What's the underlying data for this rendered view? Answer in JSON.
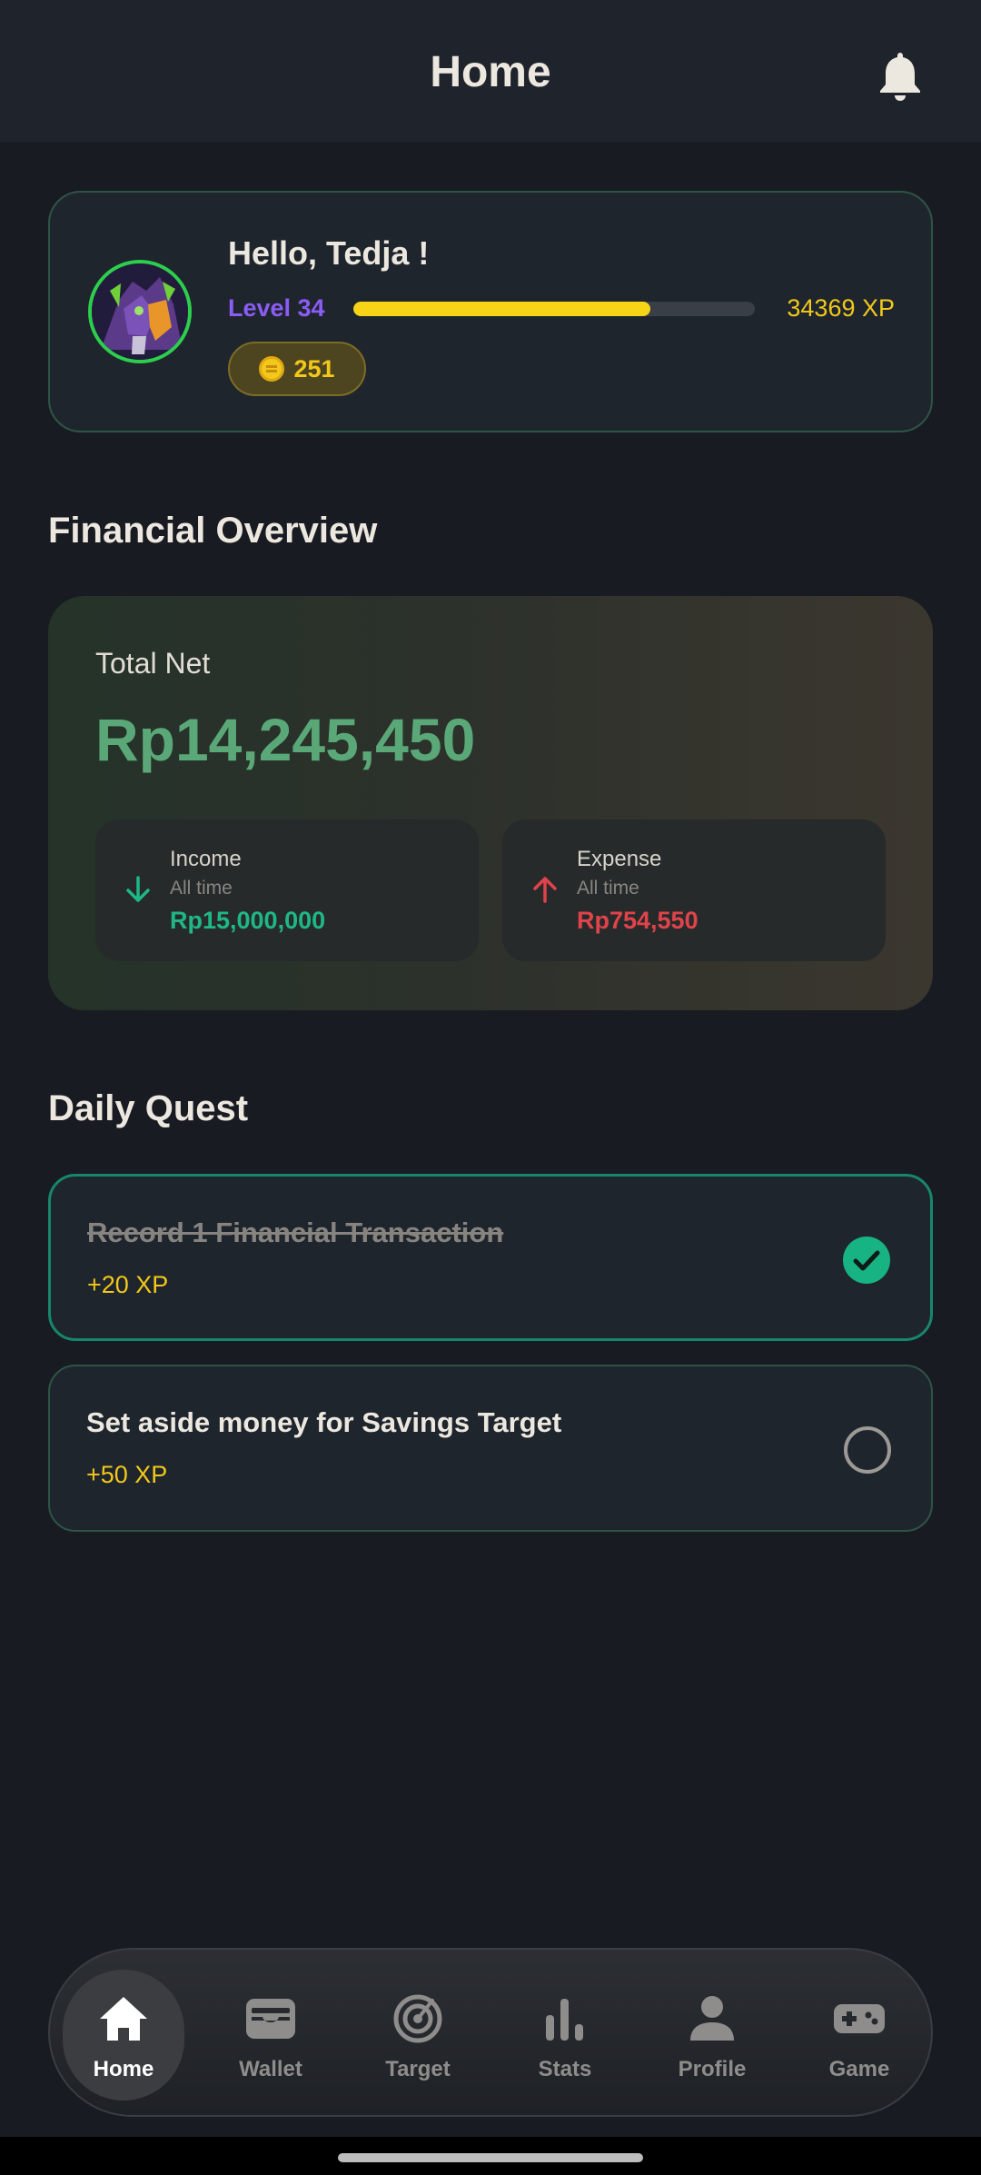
{
  "header": {
    "title": "Home",
    "notification_icon": "bell-icon"
  },
  "profile": {
    "greeting": "Hello, Tedja !",
    "level_label": "Level 34",
    "xp_label": "34369 XP",
    "xp_progress": 0.74,
    "coins": "251",
    "coin_icon": "coin-icon"
  },
  "overview": {
    "section_title": "Financial Overview",
    "total_label": "Total Net",
    "total_value": "Rp14,245,450",
    "income": {
      "label": "Income",
      "period": "All time",
      "value": "Rp15,000,000",
      "icon": "arrow-down-icon"
    },
    "expense": {
      "label": "Expense",
      "period": "All time",
      "value": "Rp754,550",
      "icon": "arrow-up-icon"
    }
  },
  "quests": {
    "section_title": "Daily Quest",
    "items": [
      {
        "title": "Record 1 Financial Transaction",
        "xp": "+20 XP",
        "completed": true
      },
      {
        "title": "Set aside money for Savings Target",
        "xp": "+50 XP",
        "completed": false
      }
    ]
  },
  "nav": {
    "items": [
      {
        "label": "Home",
        "icon": "home-icon",
        "active": true
      },
      {
        "label": "Wallet",
        "icon": "wallet-icon",
        "active": false
      },
      {
        "label": "Target",
        "icon": "target-icon",
        "active": false
      },
      {
        "label": "Stats",
        "icon": "bar-chart-icon",
        "active": false
      },
      {
        "label": "Profile",
        "icon": "person-icon",
        "active": false
      },
      {
        "label": "Game",
        "icon": "gamepad-icon",
        "active": false
      }
    ]
  },
  "colors": {
    "accent_purple": "#8b5cf6",
    "xp_yellow": "#f2c81b",
    "income_green": "#1fb785",
    "expense_red": "#e0434a",
    "total_green": "#5aa877"
  }
}
